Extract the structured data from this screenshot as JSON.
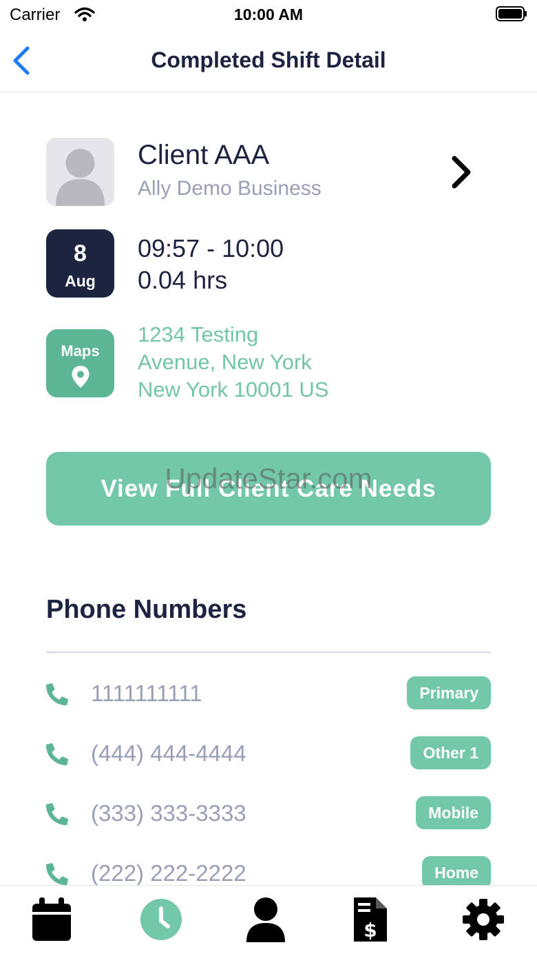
{
  "status_bar": {
    "carrier": "Carrier",
    "time": "10:00 AM"
  },
  "nav": {
    "title": "Completed Shift Detail"
  },
  "client": {
    "name": "Client AAA",
    "business": "Ally Demo Business"
  },
  "shift": {
    "day": "8",
    "month": "Aug",
    "time_range": "09:57 - 10:00",
    "hours": "0.04 hrs"
  },
  "location": {
    "maps_label": "Maps",
    "address_lines": [
      "1234 Testing",
      "Avenue, New York",
      "New York 10001 US"
    ]
  },
  "care_needs_button": "View Full Client Care Needs",
  "watermark": "UpdateStar.com",
  "phones": {
    "title": "Phone Numbers",
    "items": [
      {
        "number": "1111111111",
        "tag": "Primary"
      },
      {
        "number": "(444) 444-4444",
        "tag": "Other 1"
      },
      {
        "number": "(333) 333-3333",
        "tag": "Mobile"
      },
      {
        "number": "(222) 222-2222",
        "tag": "Home"
      }
    ]
  },
  "tabs": [
    {
      "icon": "calendar-icon"
    },
    {
      "icon": "clock-icon",
      "active": true
    },
    {
      "icon": "person-icon"
    },
    {
      "icon": "invoice-icon"
    },
    {
      "icon": "gear-icon"
    }
  ],
  "colors": {
    "navy": "#1c2440",
    "accent_green": "#73c8aa",
    "maps_green": "#5cb595",
    "muted_text": "#9a9fb8",
    "ios_blue": "#1e7cf2"
  }
}
